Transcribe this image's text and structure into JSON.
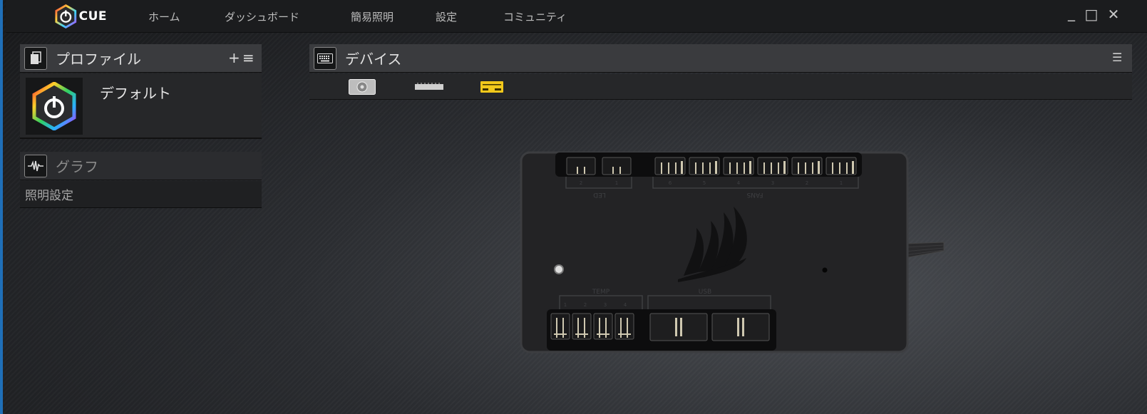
{
  "app": {
    "logo_text": "CUE"
  },
  "nav": {
    "items": [
      "ホーム",
      "ダッシュボード",
      "簡易照明",
      "設定",
      "コミュニティ"
    ]
  },
  "window_controls": {
    "minimize": "_",
    "maximize": "□",
    "close": "✕"
  },
  "profiles": {
    "title": "プロファイル",
    "add": "+",
    "menu": "≡",
    "items": [
      {
        "name": "デフォルト"
      }
    ]
  },
  "graph": {
    "title": "グラフ"
  },
  "lighting": {
    "label": "照明設定"
  },
  "devices": {
    "title": "デバイス",
    "menu": "☰",
    "tabs": [
      {
        "name": "fan-controller",
        "active": false
      },
      {
        "name": "memory",
        "active": false
      },
      {
        "name": "commander-pro",
        "active": true
      }
    ]
  },
  "hub": {
    "led_label": "LED",
    "led_ports": [
      "2",
      "1"
    ],
    "fans_label": "FANS",
    "fan_ports": [
      "6",
      "5",
      "4",
      "3",
      "2",
      "1"
    ],
    "temp_label": "TEMP",
    "temp_ports": [
      "1",
      "2",
      "3",
      "4"
    ],
    "usb_label": "USB"
  },
  "colors": {
    "accent": "#f2c81b",
    "panel": "#3a3b3e",
    "titlebar": "#1b1c1e"
  }
}
